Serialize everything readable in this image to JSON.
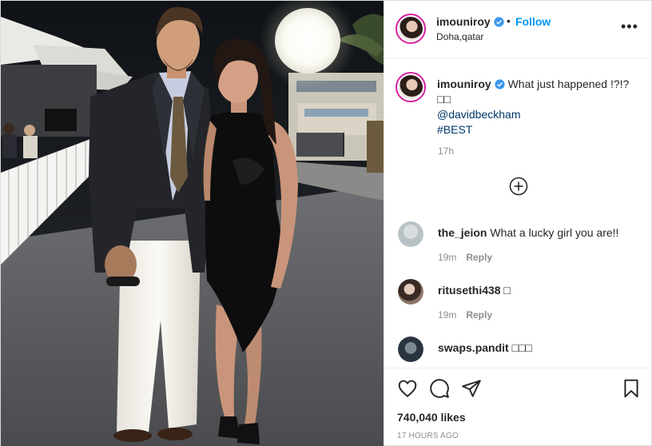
{
  "post": {
    "author": {
      "username": "imouniroy",
      "verified": true,
      "location": "Doha,qatar",
      "follow_label": "Follow",
      "separator": "•"
    },
    "more_icon": "more-options-icon",
    "more_label": "•••",
    "caption": {
      "username": "imouniroy",
      "text": "What just happened !?!?□□",
      "mention": "@davidbeckham",
      "hashtag": "#BEST",
      "time": "17h"
    },
    "load_more_icon": "plus-circle-icon",
    "comments": [
      {
        "username": "the_jeion",
        "text": "What a lucky girl you are!!",
        "time": "19m",
        "reply_label": "Reply"
      },
      {
        "username": "ritusethi438",
        "text": "□",
        "time": "19m",
        "reply_label": "Reply"
      },
      {
        "username": "swaps.pandit",
        "text": "□□□",
        "time": "",
        "reply_label": ""
      }
    ],
    "actions": [
      "heart-icon",
      "comment-icon",
      "share-icon",
      "bookmark-icon"
    ],
    "likes": "740,040 likes",
    "posted": "17 HOURS AGO"
  },
  "colors": {
    "accent": "#0095f6",
    "link": "#00376b",
    "muted": "#8e8e8e",
    "verified": "#3897f0",
    "story_ring": "#d6249f"
  }
}
